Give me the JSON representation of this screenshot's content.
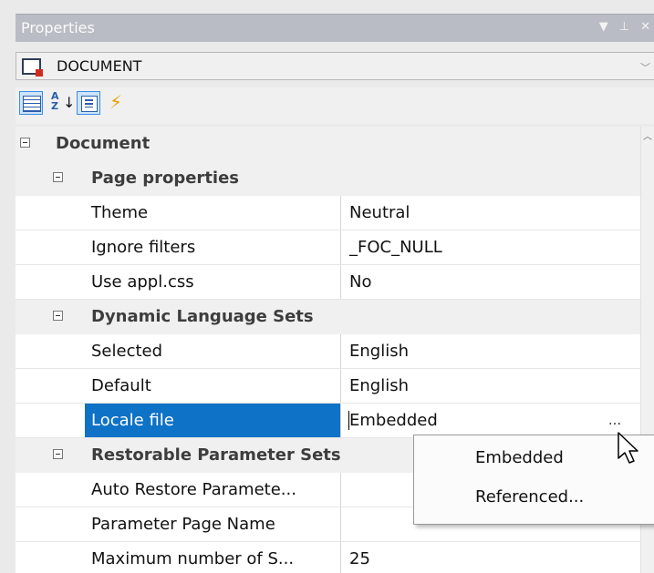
{
  "panel": {
    "title": "Properties",
    "title_icons": [
      "dropdown-arrow-icon",
      "pin-icon",
      "close-icon"
    ],
    "object_name": "DOCUMENT"
  },
  "toolbar": {
    "buttons": [
      {
        "name": "categorized",
        "icon": "categorized-icon",
        "active": true
      },
      {
        "name": "alphabetical",
        "icon": "sort-alpha-icon",
        "active": false
      },
      {
        "name": "property-pages",
        "icon": "property-pages-icon",
        "active": true
      },
      {
        "name": "events",
        "icon": "lightning-icon",
        "active": false
      }
    ]
  },
  "grid": {
    "rows": [
      {
        "kind": "category",
        "level": 0,
        "label": "Document"
      },
      {
        "kind": "category",
        "level": 1,
        "label": "Page properties"
      },
      {
        "kind": "property",
        "name": "Theme",
        "value": "Neutral"
      },
      {
        "kind": "property",
        "name": "Ignore filters",
        "value": "_FOC_NULL"
      },
      {
        "kind": "property",
        "name": "Use appl.css",
        "value": "No"
      },
      {
        "kind": "category",
        "level": 1,
        "label": "Dynamic Language Sets"
      },
      {
        "kind": "property",
        "name": "Selected",
        "value": "English"
      },
      {
        "kind": "property",
        "name": "Default",
        "value": "English"
      },
      {
        "kind": "property",
        "name": "Locale file",
        "value": "Embedded",
        "selected": true,
        "has_ellipsis": true
      },
      {
        "kind": "category",
        "level": 1,
        "label": "Restorable Parameter Sets"
      },
      {
        "kind": "property",
        "name": "Auto Restore Paramete...",
        "value": ""
      },
      {
        "kind": "property",
        "name": "Parameter Page Name",
        "value": ""
      },
      {
        "kind": "property",
        "name": "Maximum number of S...",
        "value": "25"
      }
    ],
    "ellipsis_label": "...",
    "selected_color": "#0e72c6"
  },
  "dropdown": {
    "options": [
      "Embedded",
      "Referenced..."
    ]
  }
}
